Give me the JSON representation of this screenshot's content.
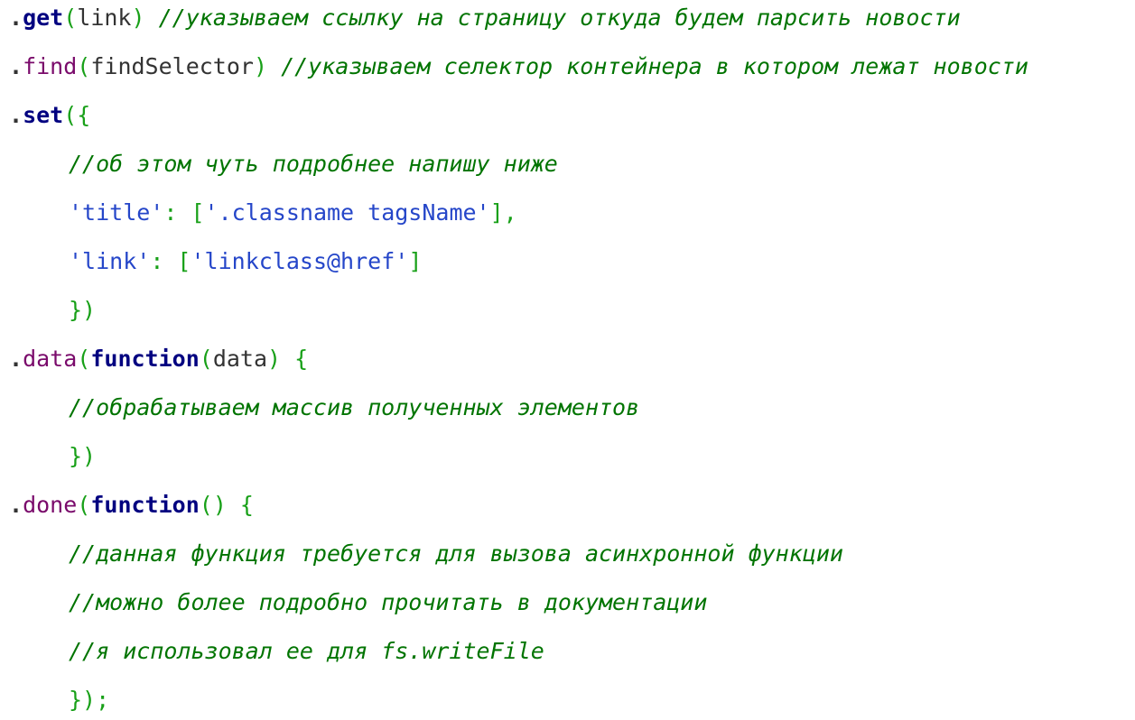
{
  "lines": {
    "l1": {
      "dot": ".",
      "method": "get",
      "open": "(",
      "arg": "link",
      "close": ")",
      "comment": " //указываем ссылку на страницу откуда будем парсить новости"
    },
    "l2": {
      "dot": ".",
      "method": "find",
      "open": "(",
      "arg": "findSelector",
      "close": ")",
      "comment": " //указываем селектор контейнера в котором лежат новости"
    },
    "l3": {
      "dot": ".",
      "method": "set",
      "open": "({"
    },
    "l4": {
      "comment": "//об этом чуть подробнее напишу ниже"
    },
    "l5": {
      "key": "'title'",
      "colon": ": ",
      "open": "[",
      "value": "'.classname tagsName'",
      "close": "],"
    },
    "l6": {
      "key": "'link'",
      "colon": ": ",
      "open": "[",
      "value": "'linkclass@href'",
      "close": "]"
    },
    "l7": {
      "close": "})"
    },
    "l8": {
      "dot": ".",
      "method": "data",
      "open": "(",
      "kw": "function",
      "open2": "(",
      "arg": "data",
      "close": ")",
      "brace": " {"
    },
    "l9": {
      "comment": "//обрабатываем массив полученных элементов"
    },
    "l10": {
      "close": "})"
    },
    "l11": {
      "dot": ".",
      "method": "done",
      "open": "(",
      "kw": "function",
      "parens": "()",
      "brace": " {"
    },
    "l12": {
      "comment": "//данная функция требуется для вызова асинхронной функции"
    },
    "l13": {
      "comment": "//можно более подробно прочитать в документации"
    },
    "l14": {
      "comment": "//я использовал ее для fs.writeFile"
    },
    "l15": {
      "close": "});"
    }
  },
  "colors": {
    "keyword": "#000080",
    "method": "#7a0a6b",
    "punctuation": "#18a018",
    "string": "#2546c9",
    "comment": "#007400"
  }
}
